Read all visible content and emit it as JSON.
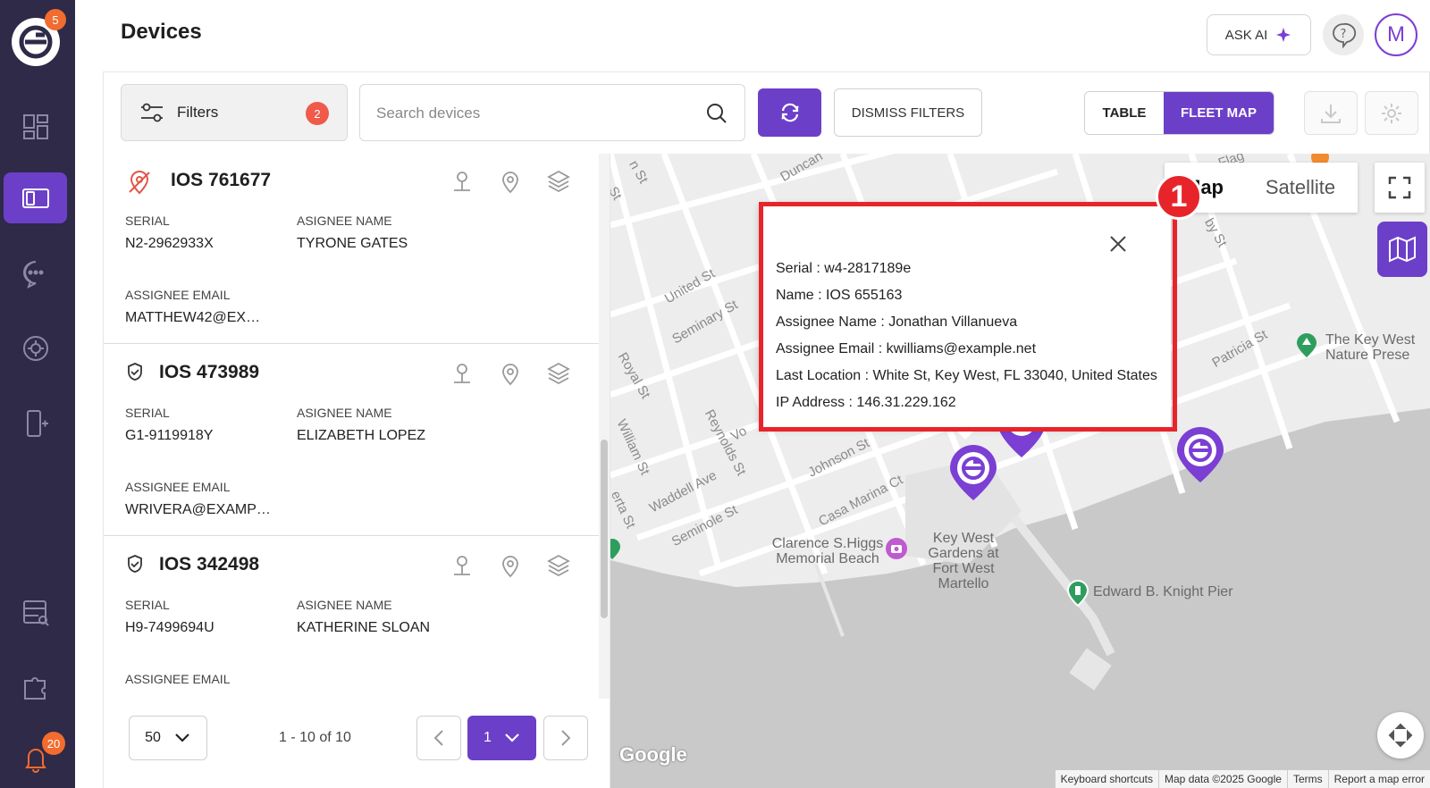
{
  "nav": {
    "logo_badge": "5",
    "bell_badge": "20",
    "items": [
      {
        "name": "dashboard-icon"
      },
      {
        "name": "devices-icon",
        "active": true
      },
      {
        "name": "chat-icon"
      },
      {
        "name": "settings-sync-icon"
      },
      {
        "name": "add-device-icon"
      },
      {
        "name": "reports-icon"
      },
      {
        "name": "integrations-icon"
      },
      {
        "name": "bell-icon"
      }
    ]
  },
  "header": {
    "title": "Devices",
    "ask_ai": "ASK AI",
    "avatar": "M"
  },
  "toolbar": {
    "filters_label": "Filters",
    "filters_count": "2",
    "search_placeholder": "Search devices",
    "dismiss_label": "DISMISS FILTERS",
    "view_table": "TABLE",
    "view_fleet_map": "FLEET MAP"
  },
  "device_labels": {
    "serial": "SERIAL",
    "assignee_name": "ASIGNEE NAME",
    "assignee_email": "ASSIGNEE EMAIL"
  },
  "devices": [
    {
      "name": "IOS 761677",
      "serial": "N2-2962933X",
      "assignee": "TYRONE GATES",
      "email": "MATTHEW42@EX…",
      "status": "location-off-icon"
    },
    {
      "name": "IOS 473989",
      "serial": "G1-9119918Y",
      "assignee": "ELIZABETH LOPEZ",
      "email": "WRIVERA@EXAMP…",
      "status": "shield-icon"
    },
    {
      "name": "IOS 342498",
      "serial": "H9-7499694U",
      "assignee": "KATHERINE SLOAN",
      "email": "",
      "status": "shield-icon"
    }
  ],
  "pagination": {
    "per_page": "50",
    "range": "1 - 10 of 10",
    "current_page": "1"
  },
  "map": {
    "map_type_map": "Map",
    "map_type_satellite": "Satellite",
    "popup": {
      "serial": "Serial : w4-2817189e",
      "name": "Name : IOS 655163",
      "assignee_name": "Assignee Name : Jonathan Villanueva",
      "assignee_email": "Assignee Email : kwilliams@example.net",
      "last_location": "Last Location : White St, Key West, FL 33040, United States",
      "ip": "IP Address : 146.31.229.162"
    },
    "annotation_number": "1",
    "streets": [
      "Duncan",
      "United St",
      "Seminary St",
      "Royal St",
      "Reynolds St",
      "William St",
      "Waddell Ave",
      "Johnson St",
      "Casa Marina Ct",
      "Seminole St",
      "Patricia St",
      "Vo",
      "by St",
      "n St",
      "St",
      "erta St",
      "Flag"
    ],
    "pois": {
      "key_west_nature": "The Key West Nature Prese",
      "clarence": "Clarence S.Higgs Memorial Beach",
      "key_west_gardens": "Key West Gardens at Fort West Martello",
      "pier": "Edward B. Knight Pier"
    },
    "google": "Google",
    "attribution": [
      "Keyboard shortcuts",
      "Map data ©2025 Google",
      "Terms",
      "Report a map error"
    ],
    "brand_color": "#6c3fc9",
    "annotation_color": "#e8242b"
  }
}
